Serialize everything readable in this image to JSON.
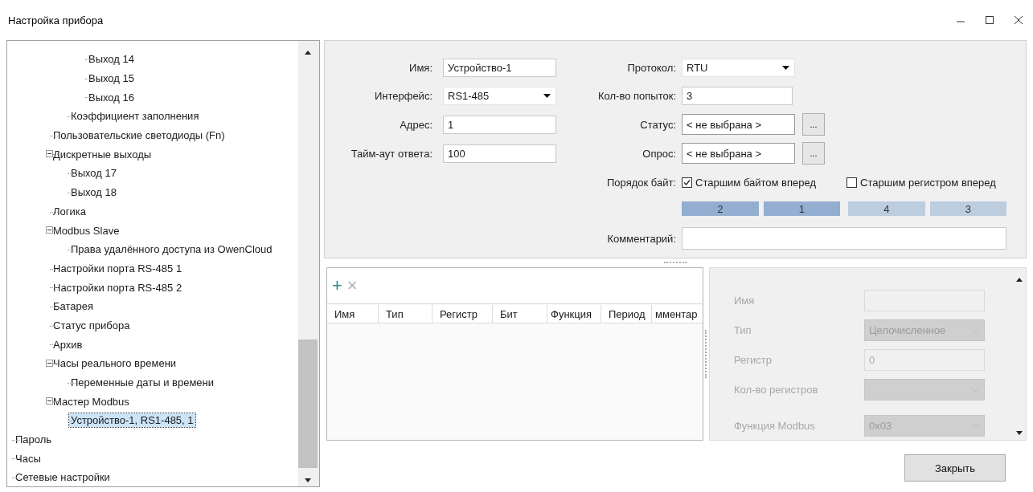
{
  "window": {
    "title": "Настройка прибора"
  },
  "tree": [
    {
      "children": [
        {
          "children": [
            {
              "children": [
                {
                  "label": "Выход 14",
                  "selected": false
                },
                {
                  "label": "Выход 15",
                  "selected": false
                },
                {
                  "label": "Выход 16",
                  "selected": false
                }
              ]
            },
            {
              "label": "Коэффициент заполнения",
              "selected": false
            }
          ]
        },
        {
          "label": "Пользовательские светодиоды (Fn)",
          "selected": false
        },
        {
          "label": "Дискретные выходы",
          "selected": false,
          "expanded": true,
          "children": [
            {
              "label": "Выход 17",
              "selected": false
            },
            {
              "label": "Выход 18",
              "selected": false
            }
          ]
        },
        {
          "label": "Логика",
          "selected": false
        },
        {
          "label": "Modbus Slave",
          "selected": false,
          "expanded": true,
          "children": [
            {
              "label": "Права удалённого доступа из OwenCloud",
              "selected": false
            }
          ]
        },
        {
          "label": "Настройки порта RS-485 1",
          "selected": false
        },
        {
          "label": "Настройки порта RS-485 2",
          "selected": false
        },
        {
          "label": "Батарея",
          "selected": false
        },
        {
          "label": "Статус прибора",
          "selected": false
        },
        {
          "label": "Архив",
          "selected": false
        },
        {
          "label": "Часы реального времени",
          "selected": false,
          "expanded": true,
          "children": [
            {
              "label": "Переменные даты и времени",
              "selected": false
            }
          ]
        },
        {
          "label": "Мастер Modbus",
          "selected": false,
          "expanded": true,
          "children": [
            {
              "label": "Устройство-1, RS1-485, 1",
              "selected": true
            }
          ]
        }
      ]
    },
    {
      "label": "Пароль",
      "selected": false
    },
    {
      "label": "Часы",
      "selected": false
    },
    {
      "label": "Сетевые настройки",
      "selected": false
    }
  ],
  "device_form": {
    "left_fields": [
      {
        "label": "Имя:",
        "kind": "text",
        "value": "Устройство-1"
      },
      {
        "label": "Интерфейс:",
        "kind": "dropdown",
        "value": "RS1-485"
      },
      {
        "label": "Адрес:",
        "kind": "text",
        "value": "1"
      },
      {
        "label": "Тайм-аут ответа:",
        "kind": "text",
        "value": "100"
      }
    ],
    "right_fields": [
      {
        "label": "Протокол:",
        "kind": "dropdown",
        "value": "RTU"
      },
      {
        "label": "Кол-во попыток:",
        "kind": "text",
        "value": "3"
      },
      {
        "label": "Статус:",
        "kind": "picker",
        "value": "< не выбрана >",
        "button": "..."
      },
      {
        "label": "Опрос:",
        "kind": "picker",
        "value": "< не выбрана >",
        "button": "..."
      }
    ],
    "byte_order": {
      "label": "Порядок байт:",
      "options": [
        {
          "label": "Старшим байтом вперед",
          "checked": true
        },
        {
          "label": "Старшим регистром вперед",
          "checked": false
        }
      ],
      "blocks": [
        {
          "label": "2",
          "color": "#93aed0"
        },
        {
          "label": "1",
          "color": "#93aed0"
        },
        {
          "label": "4",
          "color": "#bdcde0"
        },
        {
          "label": "3",
          "color": "#bdcde0"
        }
      ]
    },
    "comment": {
      "label": "Комментарий:"
    }
  },
  "variables_table": {
    "toolbar": [
      "+",
      "×"
    ],
    "columns": [
      "Имя",
      "Тип",
      "Регистр",
      "Бит",
      "Функция",
      "Период",
      "мментар"
    ]
  },
  "variable_props": [
    {
      "label": "Имя",
      "kind": "text",
      "disabled": true
    },
    {
      "label": "Тип",
      "kind": "dropdown",
      "value": "Целочисленное",
      "disabled": true
    },
    {
      "label": "Регистр",
      "kind": "text",
      "value": "0",
      "disabled": true
    },
    {
      "label": "Кол-во регистров",
      "kind": "dropdown",
      "disabled": true
    },
    {
      "label": "Функция Modbus",
      "kind": "dropdown",
      "value": "0x03",
      "disabled": true
    }
  ],
  "buttons": [
    {
      "label": "Закрыть"
    }
  ]
}
